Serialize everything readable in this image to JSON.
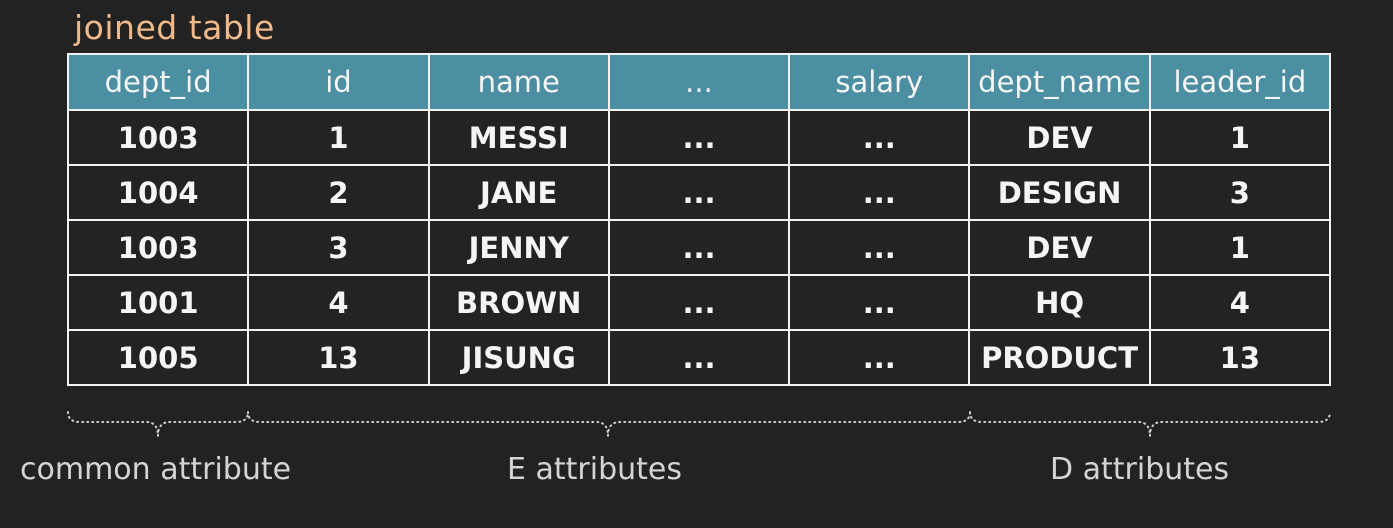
{
  "title": "joined table",
  "table": {
    "headers": [
      "dept_id",
      "id",
      "name",
      "...",
      "salary",
      "dept_name",
      "leader_id"
    ],
    "rows": [
      [
        "1003",
        "1",
        "MESSI",
        "...",
        "...",
        "DEV",
        "1"
      ],
      [
        "1004",
        "2",
        "JANE",
        "...",
        "...",
        "DESIGN",
        "3"
      ],
      [
        "1003",
        "3",
        "JENNY",
        "...",
        "...",
        "DEV",
        "1"
      ],
      [
        "1001",
        "4",
        "BROWN",
        "...",
        "...",
        "HQ",
        "4"
      ],
      [
        "1005",
        "13",
        "JISUNG",
        "...",
        "...",
        "PRODUCT",
        "13"
      ]
    ]
  },
  "groups": {
    "common": "common attribute",
    "e": "E attributes",
    "d": "D attributes"
  },
  "colors": {
    "background": "#222222",
    "header": "#4c8fa3",
    "title": "#f0b98a"
  }
}
